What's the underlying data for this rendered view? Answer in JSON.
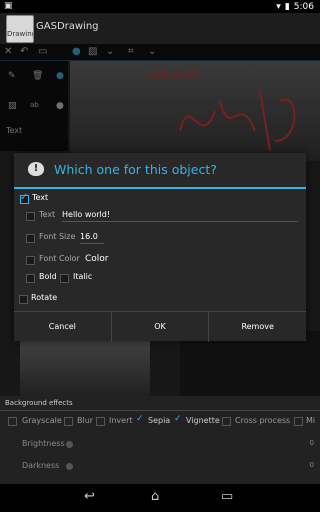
{
  "status_bar": {
    "time": "5:06"
  },
  "app": {
    "title": "GASDrawing",
    "icon_text": "Drawing"
  },
  "canvas": {
    "hello_text": "Hello world!"
  },
  "side_panel": {
    "text_label": "Text",
    "ab_label": "ab"
  },
  "dialog": {
    "title": "Which one for this object?",
    "text_section": "Text",
    "text_label": "Text",
    "text_value": "Hello world!",
    "font_size_label": "Font Size",
    "font_size_value": "16.0",
    "font_color_label": "Font Color",
    "color_label": "Color",
    "bold_label": "Bold",
    "italic_label": "Italic",
    "rotate_label": "Rotate",
    "buttons": {
      "cancel": "Cancel",
      "ok": "OK",
      "remove": "Remove"
    },
    "checked": {
      "text": true,
      "text_field": false,
      "font_size": false,
      "font_color": false,
      "bold": false,
      "italic": false,
      "rotate": false
    }
  },
  "effects": {
    "header": "Background effects",
    "items": [
      {
        "label": "Grayscale",
        "checked": false
      },
      {
        "label": "Blur",
        "checked": false
      },
      {
        "label": "Invert",
        "checked": false
      },
      {
        "label": "Sepia",
        "checked": true
      },
      {
        "label": "Vignette",
        "checked": true
      },
      {
        "label": "Cross process",
        "checked": false
      },
      {
        "label": "Mi",
        "checked": false
      }
    ],
    "brightness_label": "Brightness",
    "brightness_value": "0",
    "darkness_label": "Darkness",
    "darkness_value": "0"
  },
  "colors": {
    "accent": "#33b5e5",
    "hello_red": "#e53935"
  }
}
